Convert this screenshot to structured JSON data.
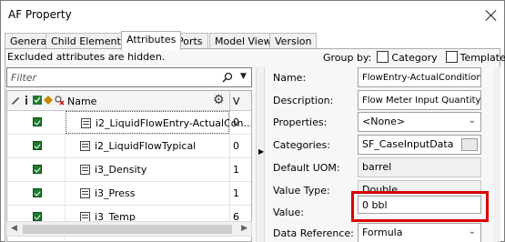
{
  "window": {
    "title": "AF Property"
  },
  "tabs": [
    "General",
    "Child Elements",
    "Attributes",
    "Ports",
    "Model View",
    "Version"
  ],
  "active_tab": "Attributes",
  "notice": "Excluded attributes are hidden.",
  "group_by": {
    "label": "Group by:",
    "category": "Category",
    "template": "Template"
  },
  "filter": {
    "placeholder": "Filter"
  },
  "grid": {
    "header_name": "Name",
    "header_value": "V",
    "rows": [
      {
        "name": "i2_LiquidFlowEntry-ActualCon...",
        "value": "0",
        "selected": true
      },
      {
        "name": "i2_LiquidFlowTypical",
        "value": "0",
        "selected": false
      },
      {
        "name": "i3_Density",
        "value": "1",
        "selected": false
      },
      {
        "name": "i3_Press",
        "value": "1",
        "selected": false
      },
      {
        "name": "i3_Temp",
        "value": "6",
        "selected": false
      }
    ]
  },
  "properties": [
    {
      "label": "Name:",
      "value": "FlowEntry-ActualConditions",
      "kind": "input"
    },
    {
      "label": "Description:",
      "value": "Flow Meter Input Quantity",
      "kind": "input"
    },
    {
      "label": "Properties:",
      "value": "<None>",
      "kind": "dropdown"
    },
    {
      "label": "Categories:",
      "value": "SF_CaseInputData",
      "kind": "browse"
    },
    {
      "label": "Default UOM:",
      "value": "barrel",
      "kind": "readonly"
    },
    {
      "label": "Value Type:",
      "value": "Double",
      "kind": "readonly"
    },
    {
      "label": "Value:",
      "value": "0 bbl",
      "kind": "input"
    },
    {
      "label": "Data Reference:",
      "value": "Formula",
      "kind": "dropdown"
    }
  ],
  "colors": {
    "highlight": "#d90000",
    "check_green": "#1f7a2e"
  }
}
